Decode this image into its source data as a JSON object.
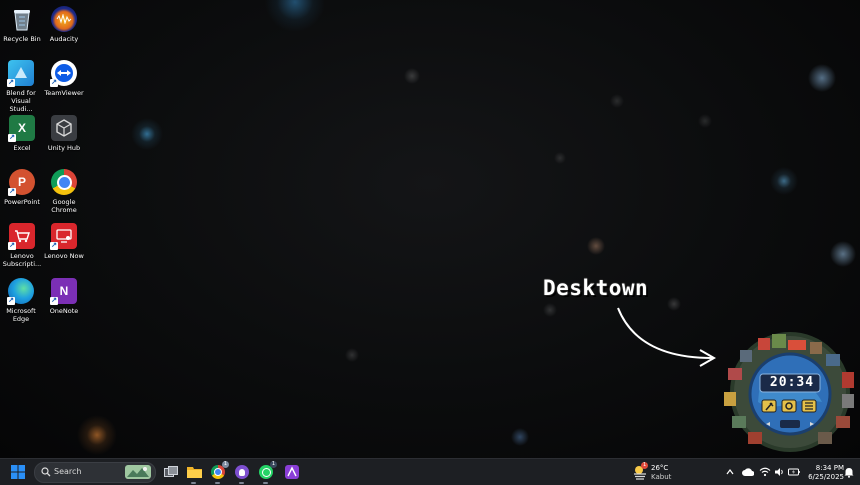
{
  "desktop_icons": [
    {
      "label": "Recycle Bin",
      "icon": "recycle-bin-icon"
    },
    {
      "label": "Audacity",
      "icon": "audacity-icon"
    },
    {
      "label": "Blend for Visual Studi...",
      "icon": "blend-icon"
    },
    {
      "label": "TeamViewer",
      "icon": "teamviewer-icon"
    },
    {
      "label": "Excel",
      "icon": "excel-icon",
      "letter": "X"
    },
    {
      "label": "Unity Hub",
      "icon": "unity-hub-icon"
    },
    {
      "label": "PowerPoint",
      "icon": "powerpoint-icon",
      "letter": "P"
    },
    {
      "label": "Google Chrome",
      "icon": "chrome-icon"
    },
    {
      "label": "Lenovo Subscripti...",
      "icon": "lenovo-subscription-icon"
    },
    {
      "label": "Lenovo Now",
      "icon": "lenovo-now-icon"
    },
    {
      "label": "Microsoft Edge",
      "icon": "edge-icon"
    },
    {
      "label": "OneNote",
      "icon": "onenote-icon",
      "letter": "N"
    }
  ],
  "annotation": {
    "title": "Desktown"
  },
  "widget": {
    "time": "20:34"
  },
  "taskbar": {
    "search_label": "Search",
    "weather": {
      "temp": "26°C",
      "condition": "Kabut",
      "badge": "1"
    },
    "clock": {
      "time": "8:34 PM",
      "date": "6/25/2025"
    },
    "whatsapp_badge": "1",
    "chrome_badge": "1"
  },
  "colors": {
    "taskbar_bg": "#1d1f23",
    "windows_blue": "#2a8ff7",
    "excel_green": "#1f7a44",
    "powerpoint_orange": "#d35230",
    "onenote_purple": "#7b2fb5",
    "lenovo_red": "#d9262c"
  }
}
